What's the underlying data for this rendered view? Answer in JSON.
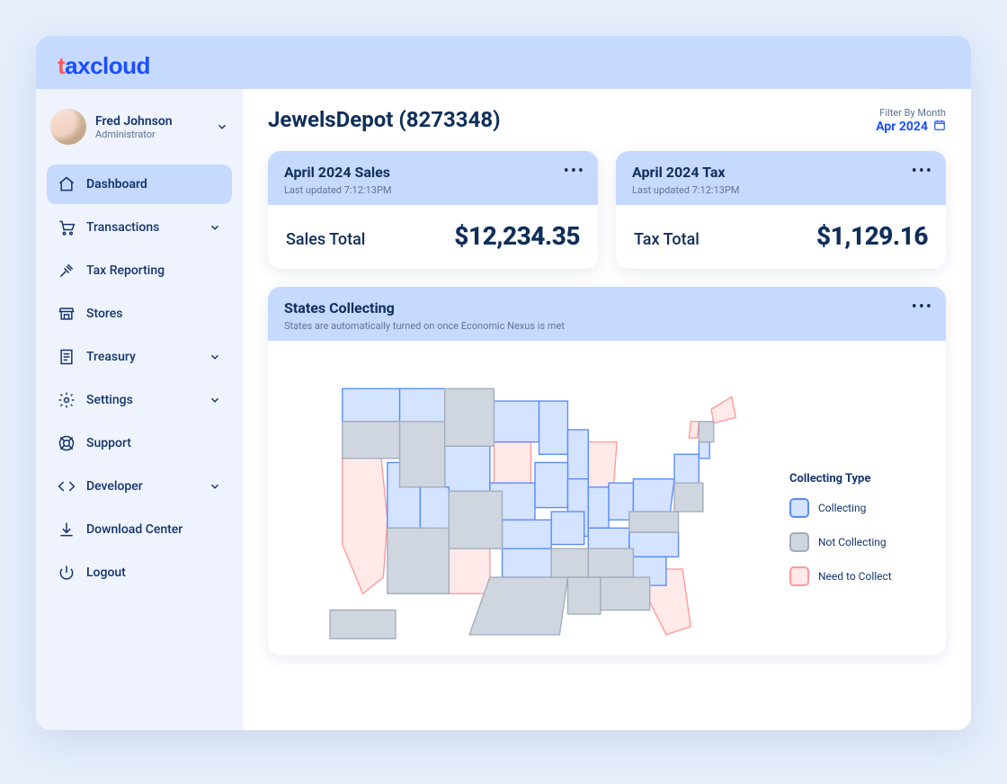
{
  "brand": "taxcloud",
  "user": {
    "name": "Fred Johnson",
    "role": "Administrator"
  },
  "nav": {
    "dashboard": "Dashboard",
    "transactions": "Transactions",
    "tax_reporting": "Tax Reporting",
    "stores": "Stores",
    "treasury": "Treasury",
    "settings": "Settings",
    "support": "Support",
    "developer": "Developer",
    "download_center": "Download Center",
    "logout": "Logout"
  },
  "page": {
    "title": "JewelsDepot (8273348)",
    "filter_label": "Filter By Month",
    "filter_month": "Apr 2024"
  },
  "kpi_sales": {
    "title": "April 2024 Sales",
    "updated": "Last updated 7:12:13PM",
    "label": "Sales Total",
    "value": "$12,234.35"
  },
  "kpi_tax": {
    "title": "April 2024 Tax",
    "updated": "Last updated 7:12:13PM",
    "label": "Tax Total",
    "value": "$1,129.16"
  },
  "map_section": {
    "title": "States Collecting",
    "subtitle": "States are automatically turned on once Economic Nexus is met"
  },
  "legend": {
    "title": "Collecting Type",
    "collecting": "Collecting",
    "not_collecting": "Not Collecting",
    "need_to_collect": "Need to Collect"
  }
}
